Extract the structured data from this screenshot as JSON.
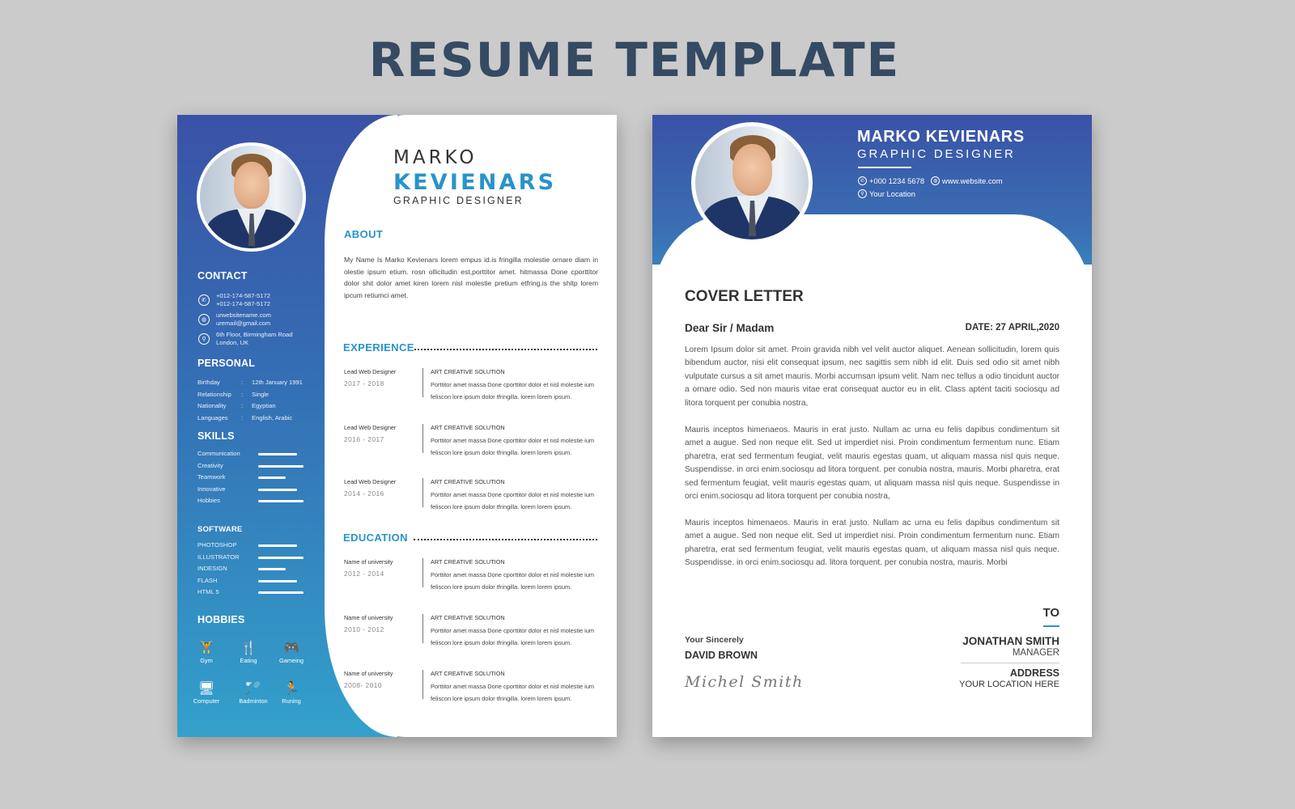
{
  "page_title": "RESUME TEMPLATE",
  "resume": {
    "name_first": "MARKO",
    "name_last": "KEVIENARS",
    "job_title": "GRAPHIC DESIGNER",
    "contact": {
      "heading": "CONTACT",
      "phone_icon": "phone-icon",
      "phones": [
        "+012-174-587-5172",
        "+012-174-587-5172"
      ],
      "web_icon": "globe-icon",
      "website": "urwebsitename.com",
      "email": "uremail@gmail.com",
      "location_icon": "location-pin-icon",
      "address_line1": "6th Floor, Birmingham Road",
      "address_line2": "London, UK"
    },
    "personal": {
      "heading": "PERSONAL",
      "rows": [
        {
          "key": "Birthday",
          "sep": ":",
          "value": "12th January 1991"
        },
        {
          "key": "Relationship",
          "sep": ":",
          "value": "Single"
        },
        {
          "key": "Nationality",
          "sep": ":",
          "value": "Egyptian"
        },
        {
          "key": "Languages",
          "sep": ":",
          "value": "English, Arabic"
        }
      ]
    },
    "skills": {
      "heading": "SKILLS",
      "items": [
        {
          "label": "Communication",
          "level": 0.85
        },
        {
          "label": "Creativity",
          "level": 1.0
        },
        {
          "label": "Teamwork",
          "level": 0.6
        },
        {
          "label": "Innovative",
          "level": 0.85
        },
        {
          "label": "Hobbies",
          "level": 1.0
        }
      ]
    },
    "software": {
      "heading": "SOFTWARE",
      "items": [
        {
          "label": "PHOTOSHOP",
          "level": 0.85
        },
        {
          "label": "ILLUSTRATOR",
          "level": 1.0
        },
        {
          "label": "INDESIGN",
          "level": 0.6
        },
        {
          "label": "FLASH",
          "level": 0.85
        },
        {
          "label": "HTML 5",
          "level": 1.0
        }
      ]
    },
    "hobbies": {
      "heading": "HOBBIES",
      "items": [
        {
          "label": "Gym",
          "icon": "dumbbell-icon",
          "glyph": "🏋"
        },
        {
          "label": "Eating",
          "icon": "dining-icon",
          "glyph": "🍴"
        },
        {
          "label": "Gameing",
          "icon": "gamepad-icon",
          "glyph": "🎮"
        },
        {
          "label": "Computer",
          "icon": "computer-icon",
          "glyph": "🖥"
        },
        {
          "label": "Badminton",
          "icon": "badminton-icon",
          "glyph": "🏸"
        },
        {
          "label": "Runing",
          "icon": "running-icon",
          "glyph": "🏃"
        }
      ]
    },
    "about": {
      "heading": "ABOUT",
      "text": "My Name Is Marko Kevienars lorem empus id.is fringilla molestie ornare diam in olestie ipsum etium. rosn ollicitudin est,porttitor amet. hitmassa Done cporttitor dolor shit dolor amet kiren lorem nisl molestie pretium etfring.is the shitp lorem ipcum retiumci amet."
    },
    "experience": {
      "heading": "EXPERIENCE",
      "entries": [
        {
          "role": "Lead  Web Designer",
          "years": "2017 - 2018",
          "org": "ART CREATIVE SOLUTION",
          "desc": "Porttitor amet massa Done cporttitor dolor et nisl molestie ium feliscon lore  ipsum dolor tfringilla. lorem lorem ipsum."
        },
        {
          "role": "Lead  Web Designer",
          "years": "2016 - 2017",
          "org": "ART CREATIVE SOLUTION",
          "desc": "Porttitor amet massa Done cporttitor dolor et nisl molestie ium feliscon lore  ipsum dolor tfringilla. lorem lorem ipsum."
        },
        {
          "role": "Lead  Web Designer",
          "years": "2014 - 2016",
          "org": "ART CREATIVE SOLUTION",
          "desc": "Porttitor amet massa Done cporttitor dolor et nisl molestie ium feliscon lore  ipsum dolor tfringilla. lorem lorem ipsum."
        }
      ]
    },
    "education": {
      "heading": "EDUCATION",
      "entries": [
        {
          "role": "Name of university",
          "years": "2012 - 2014",
          "org": "ART CREATIVE SOLUTION",
          "desc": "Porttitor amet massa Done cporttitor dolor et nisl molestie ium feliscon lore  ipsum dolor tfringilla. lorem lorem ipsum."
        },
        {
          "role": "Name of university",
          "years": "2010 - 2012",
          "org": "ART CREATIVE SOLUTION",
          "desc": "Porttitor amet massa Done cporttitor dolor et nisl molestie ium feliscon lore  ipsum dolor tfringilla. lorem lorem ipsum."
        },
        {
          "role": "Name of university",
          "years": " 2008- 2010",
          "org": "ART CREATIVE SOLUTION",
          "desc": "Porttitor amet massa Done cporttitor dolor et nisl molestie ium feliscon lore  ipsum dolor tfringilla. lorem lorem ipsum."
        }
      ]
    }
  },
  "cover": {
    "name": "MARKO KEVIENARS",
    "job_title": "GRAPHIC DESIGNER",
    "phone": "+000 1234 5678",
    "website": "www.website.com",
    "location": "Your Location",
    "heading": "COVER LETTER",
    "salutation": "Dear Sir / Madam",
    "date": "DATE: 27 APRIL,2020",
    "paragraphs": [
      "Lorem Ipsum dolor sit amet. Proin gravida nibh vel velit auctor aliquet. Aenean sollicitudin, lorem quis bibendum auctor, nisi elit consequat ipsum, nec sagittis sem nibh id elit. Duis sed odio sit amet nibh vulputate cursus a sit amet mauris. Morbi accumsan ipsum velit. Nam nec tellus a odio tincidunt auctor a ornare odio. Sed non  mauris vitae erat consequat auctor eu in elit. Class aptent taciti sociosqu ad litora torquent per conubia nostra,",
      "Mauris inceptos himenaeos. Mauris in erat justo. Nullam ac urna eu felis dapibus condimentum sit amet a augue. Sed non neque elit. Sed ut imperdiet nisi. Proin condimentum fermentum nunc. Etiam pharetra, erat sed fermentum feugiat, velit mauris egestas quam, ut aliquam massa nisl quis neque. Suspendisse. in orci enim.sociosqu ad litora torquent. per conubia nostra, mauris. Morbi pharetra, erat sed fermentum feugiat, velit mauris egestas quam, ut aliquam massa nisl quis neque. Suspendisse in orci enim.sociosqu ad litora torquent per conubia nostra,",
      "Mauris inceptos himenaeos. Mauris in erat justo. Nullam ac urna eu felis dapibus condimentum sit amet a augue. Sed non neque elit. Sed ut imperdiet nisi. Proin condimentum fermentum nunc. Etiam pharetra, erat sed fermentum feugiat, velit mauris egestas quam, ut aliquam massa nisl quis neque. Suspendisse. in orci enim.sociosqu ad. litora torquent. per conubia nostra, mauris. Morbi"
    ],
    "closing": "Your Sincerely",
    "signer": "DAVID BROWN",
    "signature": "Michel Smith",
    "to_heading": "TO",
    "recipient_name": "JONATHAN SMITH",
    "recipient_role": "MANAGER",
    "address_heading": "ADDRESS",
    "address_value": "YOUR LOCATION HERE"
  },
  "colors": {
    "accent": "#2a93c9",
    "gradient_top": "#3a52a6",
    "gradient_bottom": "#33a1cb",
    "title": "#354a63",
    "background": "#cbcbcb"
  }
}
